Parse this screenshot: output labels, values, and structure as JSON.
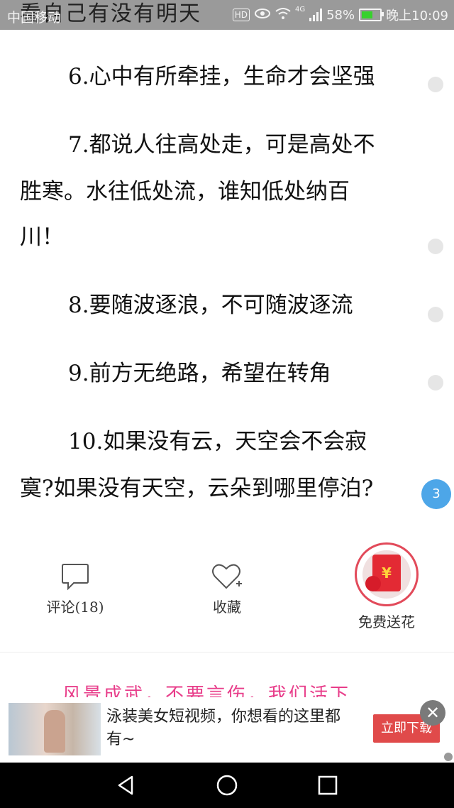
{
  "status_bar": {
    "carrier": "中国移动",
    "behind_text": "看自己有没有明天",
    "hd": "HD",
    "network": "4G",
    "battery": "58%",
    "time": "晚上10:09"
  },
  "article": {
    "lines": [
      "6.心中有所牵挂，生命才会坚强",
      "7.都说人往高处走，可是高处不",
      "胜寒。水往低处流，谁知低处纳百",
      "川！",
      "8.要随波逐浪，不可随波逐流",
      "9.前方无绝路，希望在转角",
      "10.如果没有云，天空会不会寂",
      "寞?如果没有天空，云朵到哪里停泊?"
    ],
    "comment_badge": "3"
  },
  "actions": {
    "comment_label": "评论(18)",
    "favorite_label": "收藏",
    "flower_label": "免费送花",
    "flower_symbol": "¥"
  },
  "partial_text": "风景成武，不要言伤，我们活下",
  "ad": {
    "text": "泳装美女短视频，你想看的这里都有~",
    "button": "立即下载",
    "close": "✕"
  },
  "colors": {
    "accent_red": "#e24a5a",
    "badge_blue": "#4da6e8",
    "status_bar": "#9a9a9a"
  }
}
